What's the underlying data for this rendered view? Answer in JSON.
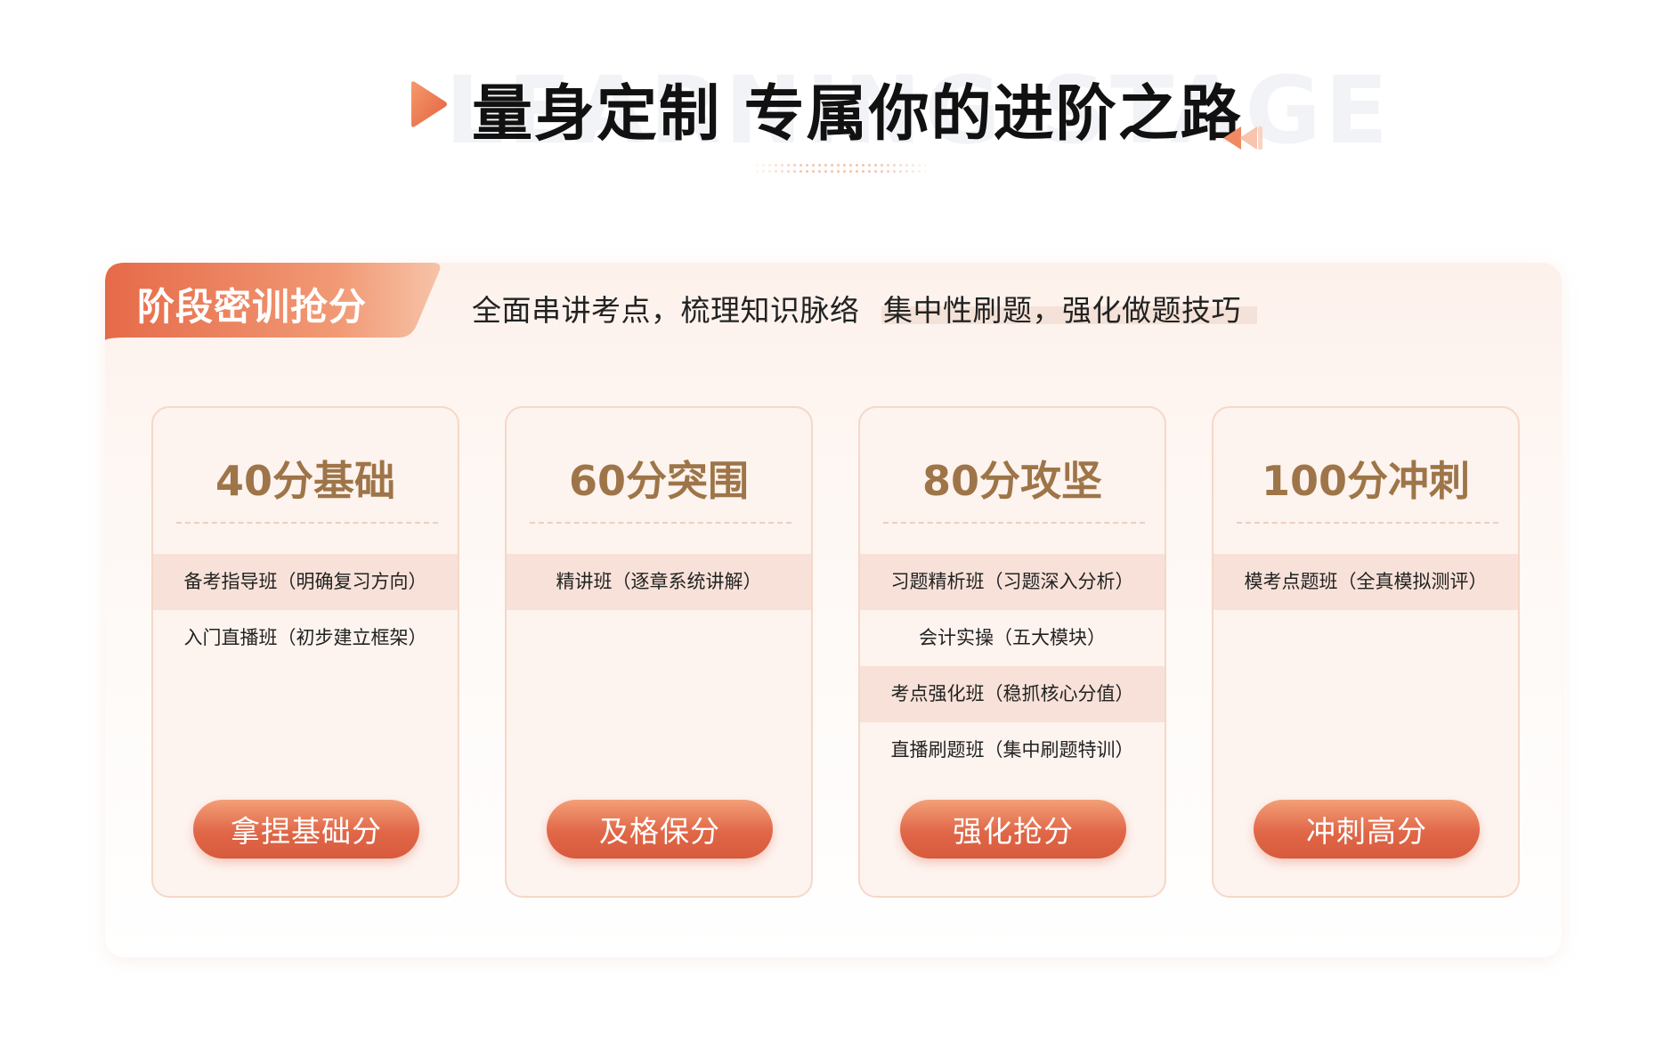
{
  "header": {
    "watermark": "LEARNING STAGE",
    "title": "量身定制 专属你的进阶之路"
  },
  "stage": {
    "tab_label": "阶段密训抢分",
    "taglines": [
      "全面串讲考点，梳理知识脉络",
      "集中性刷题，强化做题技巧"
    ]
  },
  "cards": [
    {
      "title": "40分基础",
      "courses": [
        "备考指导班（明确复习方向）",
        "入门直播班（初步建立框架）"
      ],
      "button": "拿捏基础分"
    },
    {
      "title": "60分突围",
      "courses": [
        "精讲班（逐章系统讲解）"
      ],
      "button": "及格保分"
    },
    {
      "title": "80分攻坚",
      "courses": [
        "习题精析班（习题深入分析）",
        "会计实操（五大模块）",
        "考点强化班（稳抓核心分值）",
        "直播刷题班（集中刷题特训）"
      ],
      "button": "强化抢分"
    },
    {
      "title": "100分冲刺",
      "courses": [
        "模考点题班（全真模拟测评）"
      ],
      "button": "冲刺高分"
    }
  ],
  "colors": {
    "accent": "#e8704f",
    "accent_light": "#f3a078",
    "card_title": "#9e7548",
    "card_bg": "#fdf3ef",
    "card_border": "#f5d8c8",
    "row_shade": "#f7e1d8"
  },
  "icons": [
    "play-icon",
    "rewind-icon"
  ]
}
